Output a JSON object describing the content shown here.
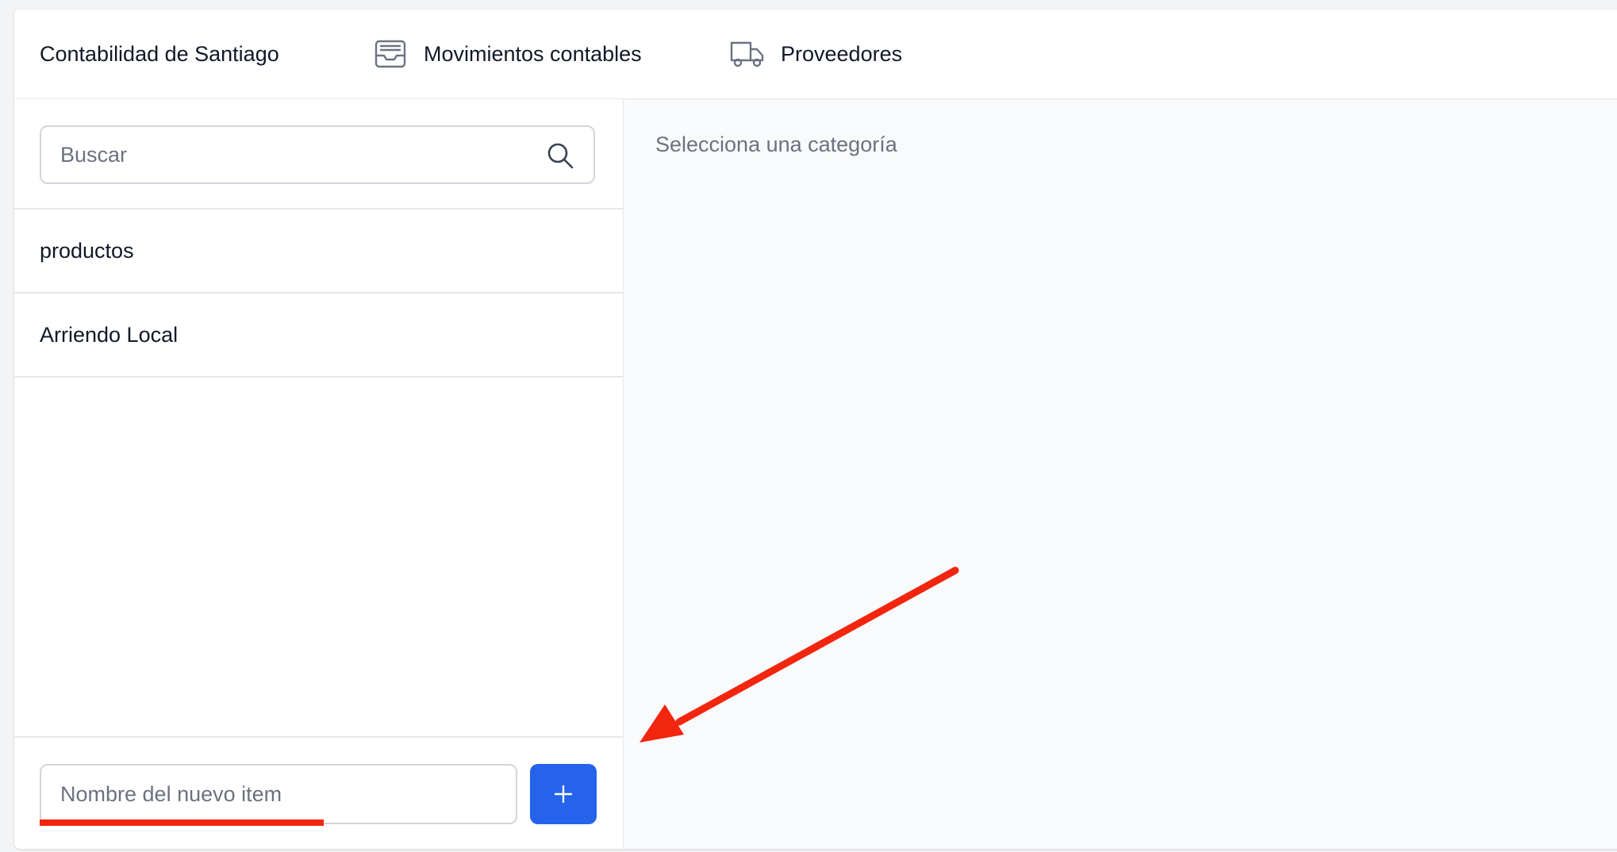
{
  "header": {
    "brand": "Contabilidad de Santiago",
    "nav": [
      {
        "label": "Movimientos contables",
        "icon": "inbox-tray-icon"
      },
      {
        "label": "Proveedores",
        "icon": "truck-icon"
      }
    ]
  },
  "sidebar": {
    "search_placeholder": "Buscar",
    "items": [
      {
        "label": "productos"
      },
      {
        "label": "Arriendo Local"
      }
    ],
    "new_item_placeholder": "Nombre del nuevo item",
    "add_button_icon": "plus-icon"
  },
  "main": {
    "empty_message": "Selecciona una categoría"
  },
  "colors": {
    "accent": "#2563eb",
    "annotation": "#f2250f",
    "border": "#e5e7eb",
    "muted_text": "#6b7280"
  }
}
